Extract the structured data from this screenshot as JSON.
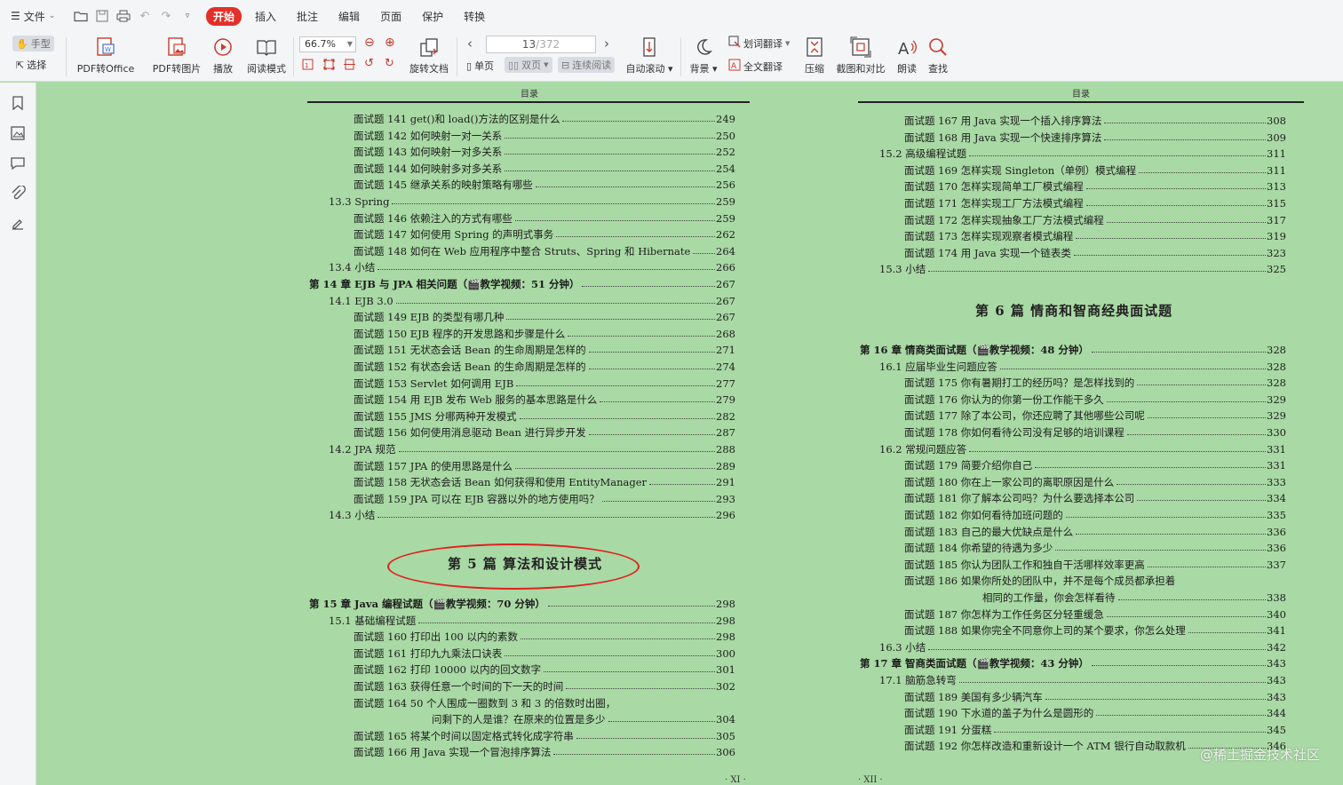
{
  "menubar": {
    "file_label": "文件",
    "tabs": [
      {
        "label": "开始",
        "active": true
      },
      {
        "label": "插入",
        "active": false
      },
      {
        "label": "批注",
        "active": false
      },
      {
        "label": "编辑",
        "active": false
      },
      {
        "label": "页面",
        "active": false
      },
      {
        "label": "保护",
        "active": false
      },
      {
        "label": "转换",
        "active": false
      }
    ],
    "accent_color": "#e4302a"
  },
  "toolbar": {
    "hand": "手型",
    "select": "选择",
    "pdf_to_office": "PDF转Office",
    "pdf_to_image": "PDF转图片",
    "play": "播放",
    "read_mode": "阅读模式",
    "zoom": "66.7%",
    "rotate": "旋转文档",
    "page_current": "13",
    "page_total": "/372",
    "single_page": "单页",
    "double_page": "双页",
    "continuous": "连续阅读",
    "auto_scroll": "自动滚动",
    "background": "背景",
    "word_translate": "划词翻译",
    "full_translate": "全文翻译",
    "compress": "压缩",
    "screenshot_compare": "截图和对比",
    "read_aloud": "朗读",
    "find": "查找"
  },
  "left_page": {
    "header": "目录",
    "entries": [
      {
        "t": "面试题 141   get()和 load()方法的区别是什么",
        "p": "249",
        "lvl": 2
      },
      {
        "t": "面试题 142   如何映射一对一关系",
        "p": "250",
        "lvl": 2
      },
      {
        "t": "面试题 143   如何映射一对多关系",
        "p": "252",
        "lvl": 2
      },
      {
        "t": "面试题 144   如何映射多对多关系",
        "p": "254",
        "lvl": 2
      },
      {
        "t": "面试题 145   继承关系的映射策略有哪些",
        "p": "256",
        "lvl": 2
      },
      {
        "t": "13.3   Spring",
        "p": "259",
        "lvl": 1
      },
      {
        "t": "面试题 146   依赖注入的方式有哪些",
        "p": "259",
        "lvl": 2
      },
      {
        "t": "面试题 147   如何使用 Spring 的声明式事务",
        "p": "262",
        "lvl": 2
      },
      {
        "t": "面试题 148   如何在 Web 应用程序中整合 Struts、Spring 和 Hibernate",
        "p": "264",
        "lvl": 2
      },
      {
        "t": "13.4   小结",
        "p": "266",
        "lvl": 1
      },
      {
        "t": "第 14 章   EJB 与 JPA 相关问题（🎬教学视频：51 分钟）",
        "p": "267",
        "lvl": 0
      },
      {
        "t": "14.1   EJB 3.0",
        "p": "267",
        "lvl": 1
      },
      {
        "t": "面试题 149   EJB 的类型有哪几种",
        "p": "267",
        "lvl": 2
      },
      {
        "t": "面试题 150   EJB 程序的开发思路和步骤是什么",
        "p": "268",
        "lvl": 2
      },
      {
        "t": "面试题 151   无状态会话 Bean 的生命周期是怎样的",
        "p": "271",
        "lvl": 2
      },
      {
        "t": "面试题 152   有状态会话 Bean 的生命周期是怎样的",
        "p": "274",
        "lvl": 2
      },
      {
        "t": "面试题 153   Servlet 如何调用 EJB",
        "p": "277",
        "lvl": 2
      },
      {
        "t": "面试题 154   用 EJB 发布 Web 服务的基本思路是什么",
        "p": "279",
        "lvl": 2
      },
      {
        "t": "面试题 155   JMS 分哪两种开发模式",
        "p": "282",
        "lvl": 2
      },
      {
        "t": "面试题 156   如何使用消息驱动 Bean 进行异步开发",
        "p": "287",
        "lvl": 2
      },
      {
        "t": "14.2   JPA 规范",
        "p": "288",
        "lvl": 1
      },
      {
        "t": "面试题 157   JPA 的使用思路是什么",
        "p": "289",
        "lvl": 2
      },
      {
        "t": "面试题 158   无状态会话 Bean 如何获得和使用 EntityManager",
        "p": "291",
        "lvl": 2
      },
      {
        "t": "面试题 159   JPA 可以在 EJB 容器以外的地方使用吗？",
        "p": "293",
        "lvl": 2
      },
      {
        "t": "14.3   小结",
        "p": "296",
        "lvl": 1
      }
    ],
    "part_title": "第 5 篇   算法和设计模式",
    "entries2": [
      {
        "t": "第 15 章   Java 编程试题（🎬教学视频：70 分钟）",
        "p": "298",
        "lvl": 0
      },
      {
        "t": "15.1   基础编程试题",
        "p": "298",
        "lvl": 1
      },
      {
        "t": "面试题 160   打印出 100 以内的素数",
        "p": "298",
        "lvl": 2
      },
      {
        "t": "面试题 161   打印九九乘法口诀表",
        "p": "300",
        "lvl": 2
      },
      {
        "t": "面试题 162   打印 10000 以内的回文数字",
        "p": "301",
        "lvl": 2
      },
      {
        "t": "面试题 163   获得任意一个时间的下一天的时间",
        "p": "302",
        "lvl": 2
      },
      {
        "t": "面试题 164   50 个人围成一圈数到 3 和 3 的倍数时出圈，",
        "p": "",
        "lvl": 2
      },
      {
        "t": "问剩下的人是谁？在原来的位置是多少",
        "p": "304",
        "lvl": 3
      },
      {
        "t": "面试题 165   将某个时间以固定格式转化成字符串",
        "p": "305",
        "lvl": 2
      },
      {
        "t": "面试题 166   用 Java 实现一个冒泡排序算法",
        "p": "306",
        "lvl": 2
      }
    ],
    "footer": "· XI ·"
  },
  "right_page": {
    "header": "目录",
    "entries": [
      {
        "t": "面试题 167   用 Java 实现一个插入排序算法",
        "p": "308",
        "lvl": 2
      },
      {
        "t": "面试题 168   用 Java 实现一个快速排序算法",
        "p": "309",
        "lvl": 2
      },
      {
        "t": "15.2   高级编程试题",
        "p": "311",
        "lvl": 1
      },
      {
        "t": "面试题 169   怎样实现 Singleton（单例）模式编程",
        "p": "311",
        "lvl": 2
      },
      {
        "t": "面试题 170   怎样实现简单工厂模式编程",
        "p": "313",
        "lvl": 2
      },
      {
        "t": "面试题 171   怎样实现工厂方法模式编程",
        "p": "315",
        "lvl": 2
      },
      {
        "t": "面试题 172   怎样实现抽象工厂方法模式编程",
        "p": "317",
        "lvl": 2
      },
      {
        "t": "面试题 173   怎样实现观察者模式编程",
        "p": "319",
        "lvl": 2
      },
      {
        "t": "面试题 174   用 Java 实现一个链表类",
        "p": "323",
        "lvl": 2
      },
      {
        "t": "15.3   小结",
        "p": "325",
        "lvl": 1
      }
    ],
    "part_title": "第 6 篇   情商和智商经典面试题",
    "entries2": [
      {
        "t": "第 16 章   情商类面试题（🎬教学视频：48 分钟）",
        "p": "328",
        "lvl": 0
      },
      {
        "t": "16.1   应届毕业生问题应答",
        "p": "328",
        "lvl": 1
      },
      {
        "t": "面试题 175   你有暑期打工的经历吗？是怎样找到的",
        "p": "328",
        "lvl": 2
      },
      {
        "t": "面试题 176   你认为的你第一份工作能干多久",
        "p": "329",
        "lvl": 2
      },
      {
        "t": "面试题 177   除了本公司，你还应聘了其他哪些公司呢",
        "p": "329",
        "lvl": 2
      },
      {
        "t": "面试题 178   你如何看待公司没有足够的培训课程",
        "p": "330",
        "lvl": 2
      },
      {
        "t": "16.2   常规问题应答",
        "p": "331",
        "lvl": 1
      },
      {
        "t": "面试题 179   简要介绍你自己",
        "p": "331",
        "lvl": 2
      },
      {
        "t": "面试题 180   你在上一家公司的离职原因是什么",
        "p": "333",
        "lvl": 2
      },
      {
        "t": "面试题 181   你了解本公司吗？为什么要选择本公司",
        "p": "334",
        "lvl": 2
      },
      {
        "t": "面试题 182   你如何看待加班问题的",
        "p": "335",
        "lvl": 2
      },
      {
        "t": "面试题 183   自己的最大优缺点是什么",
        "p": "336",
        "lvl": 2
      },
      {
        "t": "面试题 184   你希望的待遇为多少",
        "p": "336",
        "lvl": 2
      },
      {
        "t": "面试题 185   你认为团队工作和独自干活哪样效率更高",
        "p": "337",
        "lvl": 2
      },
      {
        "t": "面试题 186   如果你所处的团队中，并不是每个成员都承担着",
        "p": "",
        "lvl": 2
      },
      {
        "t": "相同的工作量，你会怎样看待",
        "p": "338",
        "lvl": 3
      },
      {
        "t": "面试题 187   你怎样为工作任务区分轻重缓急",
        "p": "340",
        "lvl": 2
      },
      {
        "t": "面试题 188   如果你完全不同意你上司的某个要求，你怎么处理",
        "p": "341",
        "lvl": 2
      },
      {
        "t": "16.3   小结",
        "p": "342",
        "lvl": 1
      },
      {
        "t": "第 17 章   智商类面试题（🎬教学视频：43 分钟）",
        "p": "343",
        "lvl": 0
      },
      {
        "t": "17.1   脑筋急转弯",
        "p": "343",
        "lvl": 1
      },
      {
        "t": "面试题 189   美国有多少辆汽车",
        "p": "343",
        "lvl": 2
      },
      {
        "t": "面试题 190   下水道的盖子为什么是圆形的",
        "p": "344",
        "lvl": 2
      },
      {
        "t": "面试题 191   分蛋糕",
        "p": "345",
        "lvl": 2
      },
      {
        "t": "面试题 192   你怎样改造和重新设计一个 ATM 银行自动取款机",
        "p": "346",
        "lvl": 2
      }
    ],
    "footer": "· XII ·"
  },
  "watermark": "@稀土掘金技术社区",
  "colors": {
    "page_bg": "#a9d9a5",
    "toolbar_bg": "#f4f5f7",
    "highlight_ellipse": "#e02020"
  }
}
